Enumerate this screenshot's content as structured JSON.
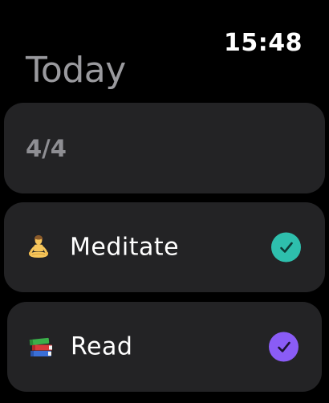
{
  "status": {
    "time": "15:48"
  },
  "page": {
    "title": "Today"
  },
  "summary": {
    "count": "4/4"
  },
  "habits": [
    {
      "label": "Meditate",
      "icon": "person-meditating-icon",
      "completed": true,
      "check_color": "#2ebfad"
    },
    {
      "label": "Read",
      "icon": "books-icon",
      "completed": true,
      "check_color": "#8a5cf6"
    }
  ],
  "colors": {
    "background": "#000000",
    "card": "#232325",
    "title": "#9a9a9e",
    "summary_text": "#8e8e93"
  }
}
